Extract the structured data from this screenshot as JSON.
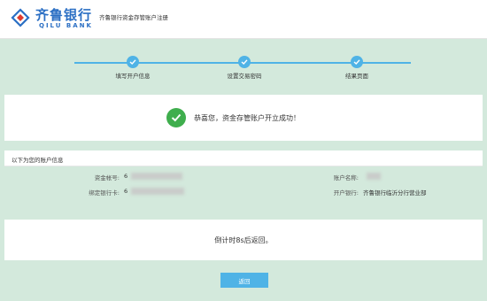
{
  "header": {
    "logo_cn": "齐鲁银行",
    "logo_en": "QILU BANK",
    "title": "齐鲁银行资金存管账户注册"
  },
  "steps": [
    {
      "label": "填写开户信息",
      "done": true
    },
    {
      "label": "设置交易密码",
      "done": true
    },
    {
      "label": "结果页面",
      "done": true
    }
  ],
  "success": {
    "message": "恭喜您，资金存管账户开立成功！"
  },
  "account_info": {
    "title": "以下为您的账户信息",
    "fund_account_label": "资金帐号:",
    "fund_account_value": "6",
    "account_name_label": "账户名称:",
    "account_name_value": "",
    "bound_card_label": "绑定银行卡:",
    "bound_card_value": "6",
    "branch_label": "开户银行:",
    "branch_value": "齐鲁银行临沂分行营业部"
  },
  "countdown": {
    "text": "倒计时8s后返回。"
  },
  "actions": {
    "back_label": "返回"
  },
  "colors": {
    "brand": "#2b6fc4",
    "accent": "#4fb3e6",
    "success": "#3fae4d",
    "background": "#d3e9dc"
  }
}
